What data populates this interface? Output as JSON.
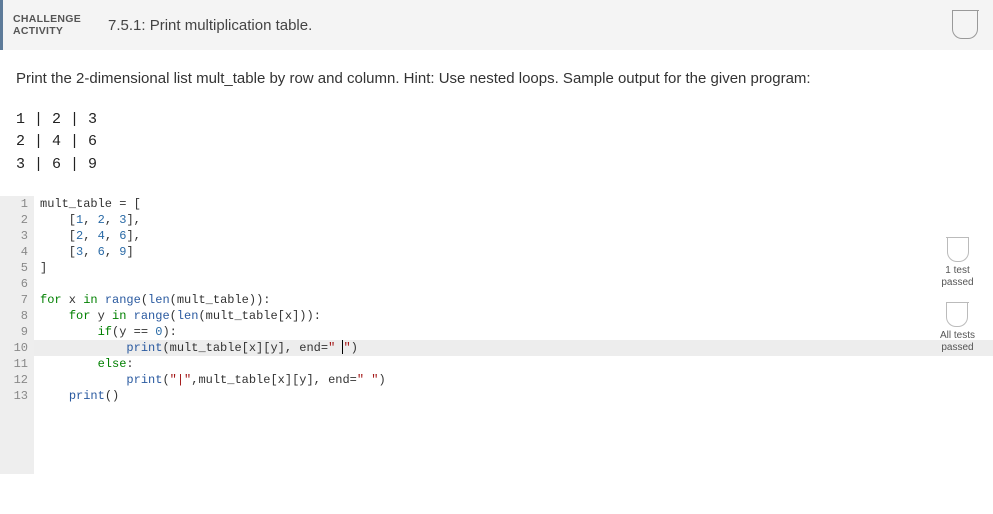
{
  "header": {
    "label_line1": "CHALLENGE",
    "label_line2": "ACTIVITY",
    "title": "7.5.1: Print multiplication table."
  },
  "instructions": "Print the 2-dimensional list mult_table by row and column. Hint: Use nested loops. Sample output for the given program:",
  "sample_output": "1 | 2 | 3\n2 | 4 | 6\n3 | 6 | 9",
  "code": {
    "line_numbers": [
      "1",
      "2",
      "3",
      "4",
      "5",
      "6",
      "7",
      "8",
      "9",
      "10",
      "11",
      "12",
      "13"
    ],
    "lines": {
      "l1_a": "mult_table = [",
      "l2_a": "    [",
      "l2_b": "1",
      "l2_c": ", ",
      "l2_d": "2",
      "l2_e": ", ",
      "l2_f": "3",
      "l2_g": "],",
      "l3_a": "    [",
      "l3_b": "2",
      "l3_c": ", ",
      "l3_d": "4",
      "l3_e": ", ",
      "l3_f": "6",
      "l3_g": "],",
      "l4_a": "    [",
      "l4_b": "3",
      "l4_c": ", ",
      "l4_d": "6",
      "l4_e": ", ",
      "l4_f": "9",
      "l4_g": "]",
      "l5_a": "]",
      "l6_a": "",
      "l7_a": "for",
      "l7_b": " x ",
      "l7_c": "in",
      "l7_d": " ",
      "l7_e": "range",
      "l7_f": "(",
      "l7_g": "len",
      "l7_h": "(mult_table)):",
      "l8_a": "    ",
      "l8_b": "for",
      "l8_c": " y ",
      "l8_d": "in",
      "l8_e": " ",
      "l8_f": "range",
      "l8_g": "(",
      "l8_h": "len",
      "l8_i": "(mult_table[x])):",
      "l9_a": "        ",
      "l9_b": "if",
      "l9_c": "(y == ",
      "l9_d": "0",
      "l9_e": "):",
      "l10_a": "            ",
      "l10_b": "print",
      "l10_c": "(mult_table[x][y], end=",
      "l10_d": "\" ",
      "l10_e": "\"",
      "l10_f": ")",
      "l11_a": "        ",
      "l11_b": "else",
      "l11_c": ":",
      "l12_a": "            ",
      "l12_b": "print",
      "l12_c": "(",
      "l12_d": "\"|\"",
      "l12_e": ",mult_table[x][y], end=",
      "l12_f": "\" \"",
      "l12_g": ")",
      "l13_a": "    ",
      "l13_b": "print",
      "l13_c": "()"
    }
  },
  "tests": [
    {
      "line1": "1 test",
      "line2": "passed"
    },
    {
      "line1": "All tests",
      "line2": "passed"
    }
  ]
}
